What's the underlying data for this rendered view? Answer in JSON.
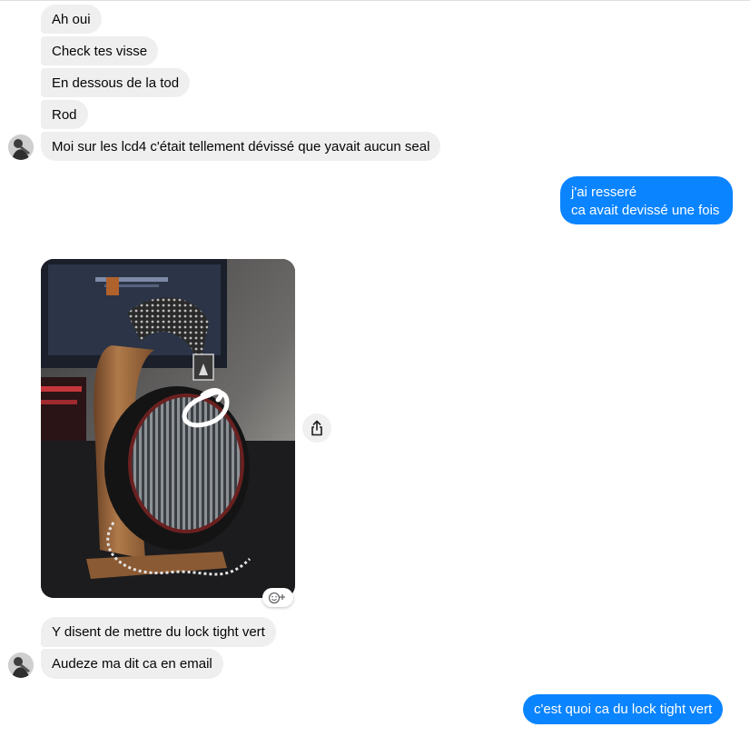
{
  "incoming_top": [
    {
      "text": "Ah oui"
    },
    {
      "text": "Check tes visse"
    },
    {
      "text": "En dessous de la tod"
    },
    {
      "text": "Rod"
    },
    {
      "text": "Moi sur les lcd4 c'était tellement dévissé que yavait aucun seal"
    }
  ],
  "outgoing_1": {
    "line1": "j'ai resseré",
    "line2": "ca avait devissé une fois"
  },
  "incoming_bottom": [
    {
      "text": "Y disent de mettre du lock tight vert"
    },
    {
      "text": "Audeze ma dit ca en email"
    }
  ],
  "outgoing_2": {
    "text": "c'est quoi ca du lock tight vert"
  },
  "icons": {
    "share": "share-icon",
    "react": "emoji-add-icon"
  },
  "colors": {
    "incoming_bubble": "#efefef",
    "outgoing_bubble": "#0a84ff",
    "outgoing_text": "#ffffff"
  }
}
